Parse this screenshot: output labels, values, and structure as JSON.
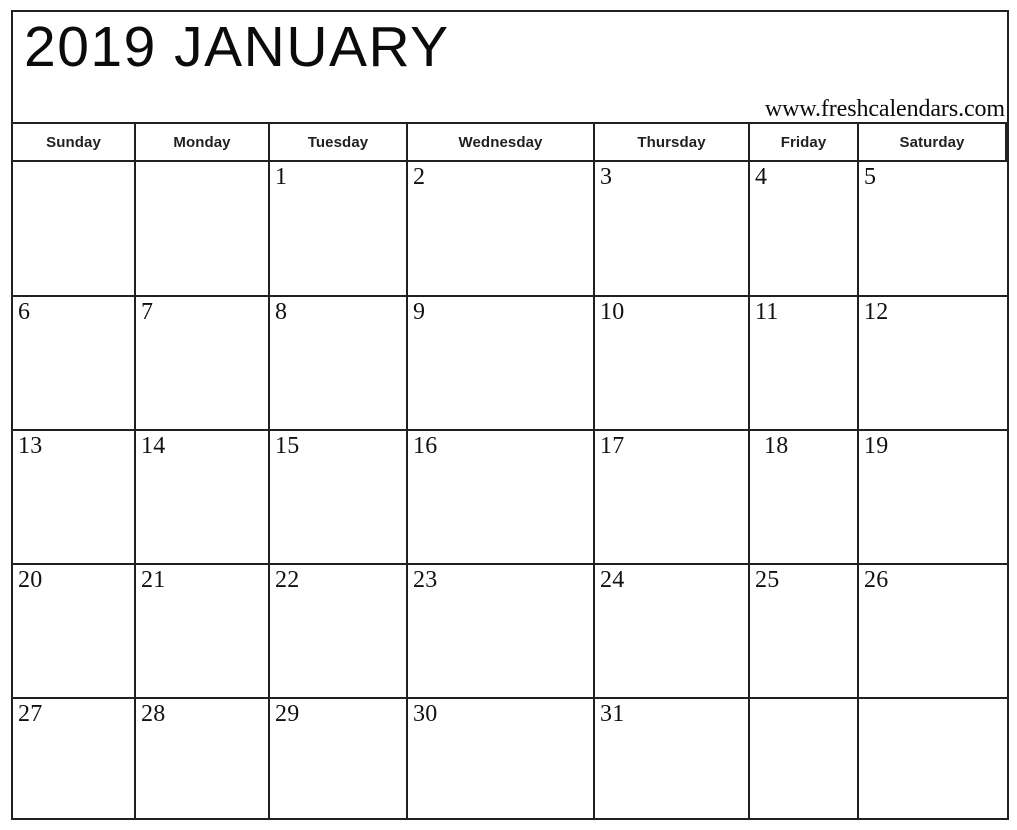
{
  "page": {
    "title": "2019 JANUARY",
    "year": "2019",
    "month": "JANUARY",
    "watermark_url": "www.freshcalendars.com",
    "ink_color": "#231f20",
    "background_color": "#ffffff"
  },
  "weekday_headers": [
    {
      "label": "Sunday"
    },
    {
      "label": "Monday"
    },
    {
      "label": "Tuesday"
    },
    {
      "label": "Wednesday"
    },
    {
      "label": "Thursday"
    },
    {
      "label": "Friday"
    },
    {
      "label": "Saturday"
    }
  ],
  "weeks": [
    {
      "days": [
        {
          "num": ""
        },
        {
          "num": ""
        },
        {
          "num": "1"
        },
        {
          "num": "2"
        },
        {
          "num": "3"
        },
        {
          "num": "4"
        },
        {
          "num": "5"
        }
      ]
    },
    {
      "days": [
        {
          "num": "6"
        },
        {
          "num": "7"
        },
        {
          "num": "8"
        },
        {
          "num": "9"
        },
        {
          "num": "10"
        },
        {
          "num": "11"
        },
        {
          "num": "12"
        }
      ]
    },
    {
      "days": [
        {
          "num": "13"
        },
        {
          "num": "14"
        },
        {
          "num": "15"
        },
        {
          "num": "16"
        },
        {
          "num": "17"
        },
        {
          "num": "18"
        },
        {
          "num": "19"
        }
      ]
    },
    {
      "days": [
        {
          "num": "20"
        },
        {
          "num": "21"
        },
        {
          "num": "22"
        },
        {
          "num": "23"
        },
        {
          "num": "24"
        },
        {
          "num": "25"
        },
        {
          "num": "26"
        }
      ]
    },
    {
      "days": [
        {
          "num": "27"
        },
        {
          "num": "28"
        },
        {
          "num": "29"
        },
        {
          "num": "30"
        },
        {
          "num": "31"
        },
        {
          "num": ""
        },
        {
          "num": ""
        }
      ]
    }
  ]
}
